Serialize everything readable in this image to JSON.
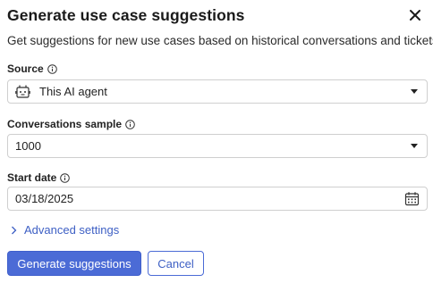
{
  "dialog": {
    "title": "Generate use case suggestions",
    "subtitle": "Get suggestions for new use cases based on historical conversations and tickets."
  },
  "source": {
    "label": "Source",
    "value": "This AI agent",
    "icon": "ai-agent-icon"
  },
  "conversations_sample": {
    "label": "Conversations sample",
    "value": "1000"
  },
  "start_date": {
    "label": "Start date",
    "value": "03/18/2025",
    "icon": "calendar-icon"
  },
  "advanced_settings": {
    "label": "Advanced settings"
  },
  "actions": {
    "primary_label": "Generate suggestions",
    "cancel_label": "Cancel"
  },
  "colors": {
    "accent": "#4b6bd6",
    "link": "#3d5fc4"
  }
}
